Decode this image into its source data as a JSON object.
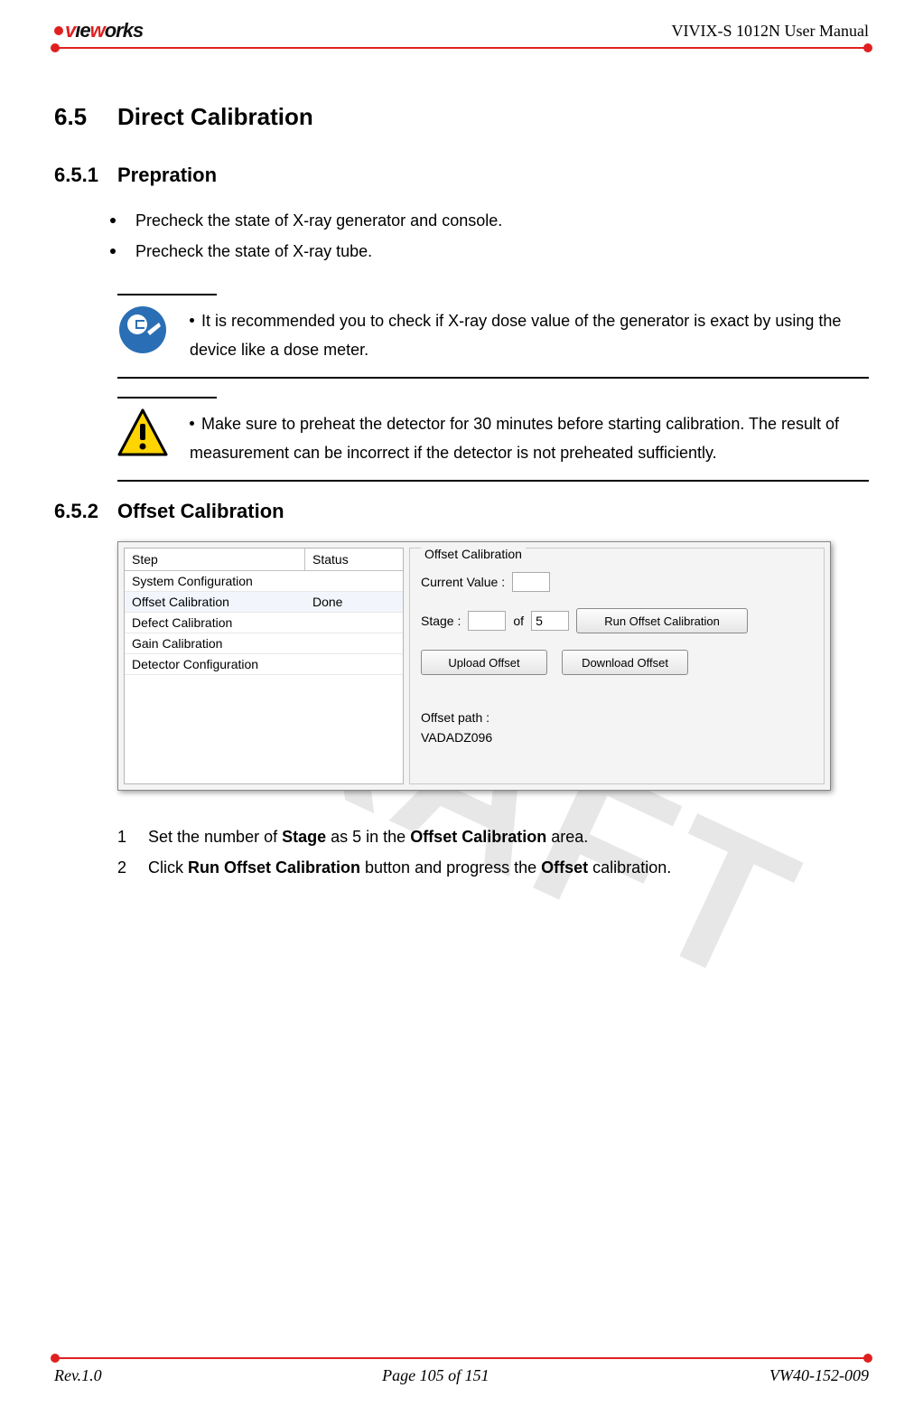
{
  "header": {
    "logo_v": "v",
    "logo_ie": "ıe",
    "logo_w": "w",
    "logo_orks": "orks",
    "doc_title": "VIVIX-S 1012N User Manual"
  },
  "watermark": "DRAFT",
  "section": {
    "num": "6.5",
    "title": "Direct Calibration"
  },
  "sub1": {
    "num": "6.5.1",
    "title": "Prepration",
    "b1": "Precheck the state of X-ray generator and console.",
    "b2": "Precheck the state of X-ray tube."
  },
  "note_info": "It is recommended you to check if X-ray dose value of the generator is exact by using the device like a dose meter.",
  "note_warn": "Make sure to preheat the detector for 30 minutes before starting calibration. The result of measurement can be incorrect if the detector is not preheated sufficiently.",
  "sub2": {
    "num": "6.5.2",
    "title": "Offset Calibration"
  },
  "shot": {
    "col_step": "Step",
    "col_status": "Status",
    "rows": {
      "r0": {
        "step": "System Configuration",
        "status": ""
      },
      "r1": {
        "step": "Offset Calibration",
        "status": "Done"
      },
      "r2": {
        "step": "Defect Calibration",
        "status": ""
      },
      "r3": {
        "step": "Gain Calibration",
        "status": ""
      },
      "r4": {
        "step": "Detector Configuration",
        "status": ""
      }
    },
    "group": "Offset Calibration",
    "lbl_current": "Current Value :",
    "lbl_stage": "Stage :",
    "lbl_of": "of",
    "val_total": "5",
    "btn_run": "Run Offset Calibration",
    "btn_upload": "Upload Offset",
    "btn_download": "Download Offset",
    "lbl_path": "Offset path :",
    "val_path": "VADADZ096"
  },
  "steps": {
    "s1a": "Set the number of ",
    "s1b": "Stage",
    "s1c": " as 5 in the ",
    "s1d": "Offset Calibration",
    "s1e": " area.",
    "s2a": "Click ",
    "s2b": "Run Offset Calibration",
    "s2c": " button and progress the ",
    "s2d": "Offset",
    "s2e": " calibration."
  },
  "footer": {
    "rev": "Rev.1.0",
    "page": "Page 105 of 151",
    "code": "VW40-152-009"
  }
}
